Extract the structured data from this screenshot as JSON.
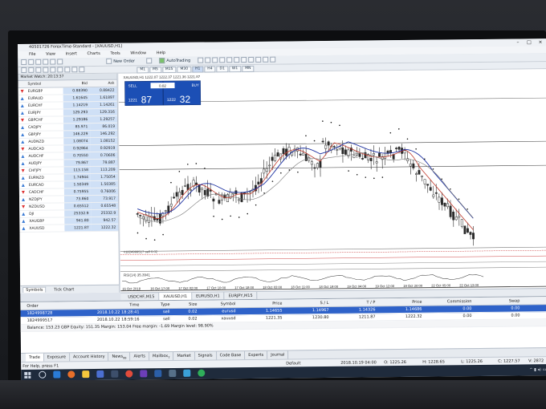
{
  "window": {
    "title": "40501726 ForexTime-Standard - [XAUUSD,H1]",
    "controls": [
      "–",
      "□",
      "×"
    ]
  },
  "menu": [
    "File",
    "View",
    "Insert",
    "Charts",
    "Tools",
    "Window",
    "Help"
  ],
  "toolbar": {
    "new_order_label": "New Order",
    "autotrading_label": "AutoTrading",
    "timeframes": [
      "M1",
      "M5",
      "M15",
      "M30",
      "H1",
      "H4",
      "D1",
      "W1",
      "MN"
    ],
    "active_timeframe": "H1"
  },
  "market_watch": {
    "title": "Market Watch: 20:13:37",
    "headers": {
      "symbol": "Symbol",
      "bid": "Bid",
      "ask": "Ask"
    },
    "rows": [
      {
        "symbol": "EURGBP",
        "bid": "0.88390",
        "ask": "0.88422",
        "dir": "down"
      },
      {
        "symbol": "EURAUD",
        "bid": "1.61645",
        "ask": "1.61897",
        "dir": "up"
      },
      {
        "symbol": "EURCHF",
        "bid": "1.14219",
        "ask": "1.14261",
        "dir": "up"
      },
      {
        "symbol": "EURJPY",
        "bid": "129.293",
        "ask": "129.316",
        "dir": "up"
      },
      {
        "symbol": "GBPCHF",
        "bid": "1.29186",
        "ask": "1.29257",
        "dir": "down"
      },
      {
        "symbol": "CADJPY",
        "bid": "85.971",
        "ask": "86.019",
        "dir": "up"
      },
      {
        "symbol": "GBPJPY",
        "bid": "146.229",
        "ask": "146.292",
        "dir": "up"
      },
      {
        "symbol": "AUDNZD",
        "bid": "1.08074",
        "ask": "1.08152",
        "dir": "up"
      },
      {
        "symbol": "AUDCAD",
        "bid": "0.92864",
        "ask": "0.92919",
        "dir": "down"
      },
      {
        "symbol": "AUDCHF",
        "bid": "0.70550",
        "ask": "0.70606",
        "dir": "up"
      },
      {
        "symbol": "AUDJPY",
        "bid": "79.867",
        "ask": "79.887",
        "dir": "up"
      },
      {
        "symbol": "CHFJPY",
        "bid": "113.158",
        "ask": "113.209",
        "dir": "down"
      },
      {
        "symbol": "EURNZD",
        "bid": "1.74944",
        "ask": "1.75054",
        "dir": "up"
      },
      {
        "symbol": "EURCAD",
        "bid": "1.50349",
        "ask": "1.50385",
        "dir": "up"
      },
      {
        "symbol": "CADCHF",
        "bid": "0.75955",
        "ask": "0.76006",
        "dir": "down"
      },
      {
        "symbol": "NZDJPY",
        "bid": "73.860",
        "ask": "73.917",
        "dir": "up"
      },
      {
        "symbol": "NZDUSD",
        "bid": "0.65512",
        "ask": "0.65548",
        "dir": "down"
      },
      {
        "symbol": "DJI",
        "bid": "25332.9",
        "ask": "25332.9",
        "dir": "up"
      },
      {
        "symbol": "XAUGBP",
        "bid": "941.80",
        "ask": "942.57",
        "dir": "up"
      },
      {
        "symbol": "XAUUSD",
        "bid": "1221.87",
        "ask": "1222.32",
        "dir": "up"
      }
    ],
    "tabs": [
      "Symbols",
      "Tick Chart"
    ]
  },
  "chart": {
    "header": "XAUUSD,H1  1222.07 1222.37 1221.36 1221.87",
    "one_click": {
      "sell_label": "SELL",
      "buy_label": "BUY",
      "lot": "0.02",
      "sell_small": "1221",
      "sell_big": "87",
      "buy_small": "1222",
      "buy_big": "32"
    },
    "order_line_label": "#1824999517 sell 0.02",
    "indicator_label": "RSI(14) 35.3941",
    "time_labels": [
      "16 Oct 2018",
      "16 Oct 17:00",
      "17 Oct 02:00",
      "17 Oct 10:00",
      "17 Oct 18:00",
      "18 Oct 03:00",
      "18 Oct 11:00",
      "18 Oct 19:00",
      "19 Oct 04:00",
      "19 Oct 12:00",
      "19 Oct 20:00",
      "22 Oct 05:00",
      "22 Oct 13:00"
    ]
  },
  "chart_tabs": [
    "USDCHF,M15",
    "XAUUSD,H1",
    "EURUSD,H1",
    "EURJPY,M15"
  ],
  "active_chart_tab": "XAUUSD,H1",
  "terminal": {
    "headers": {
      "order": "Order",
      "time": "Time",
      "type": "Type",
      "size": "Size",
      "symbol": "Symbol",
      "price": "Price",
      "sl": "S / L",
      "tp": "T / P",
      "price2": "Price",
      "commission": "Commission",
      "swap": "Swap"
    },
    "rows": [
      {
        "order": "1824998728",
        "time": "2018.10.22 18:28:41",
        "type": "sell",
        "size": "0.02",
        "symbol": "eurusd",
        "price": "1.14655",
        "sl": "1.14967",
        "tp": "1.14326",
        "price2": "1.14686",
        "commission": "0.00",
        "swap": "0.00"
      },
      {
        "order": "1824999517",
        "time": "2018.10.22 18:59:16",
        "type": "sell",
        "size": "0.02",
        "symbol": "xauusd",
        "price": "1221.35",
        "sl": "1230.80",
        "tp": "1211.87",
        "price2": "1222.32",
        "commission": "0.00",
        "swap": "0.00"
      }
    ],
    "balance": "Balance: 153.23 GBP  Equity: 151.35  Margin: 153.04  Free margin: -1.69  Margin level: 98.90%"
  },
  "terminal_tabs": [
    "Trade",
    "Exposure",
    "Account History",
    "News",
    "Alerts",
    "Mailbox",
    "Market",
    "Signals",
    "Code Base",
    "Experts",
    "Journal"
  ],
  "news_badge": "99",
  "mailbox_badge": "7",
  "active_terminal_tab": "Trade",
  "status": {
    "help": "For Help, press F1",
    "profile": "Default",
    "datetime": "2018.10.19 04:00",
    "open": "O: 1225.26",
    "high": "H: 1228.65",
    "low": "L: 1225.26",
    "close": "C: 1227.57",
    "volume": "V: 2872"
  },
  "colors": {
    "accent": "#2e62c9",
    "sell": "#1f5fd0",
    "buy": "#1f5fd0",
    "candle": "#2b2b2b",
    "ma_red": "#c0392b",
    "ma_blue": "#1a2fa0",
    "ma_grey": "#777777"
  }
}
